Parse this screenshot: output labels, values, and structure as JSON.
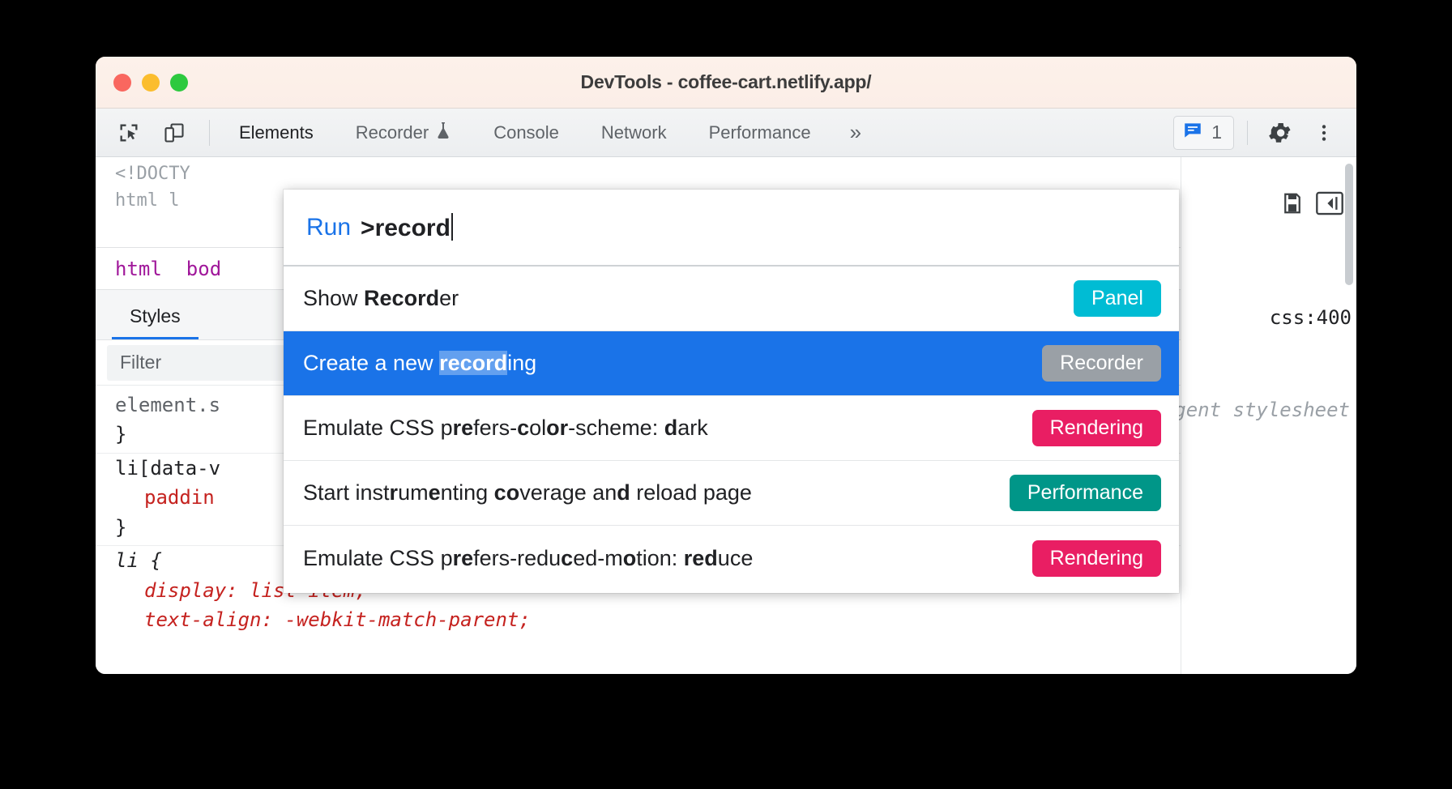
{
  "window": {
    "title": "DevTools - coffee-cart.netlify.app/",
    "traffic_lights": [
      "close-red",
      "minimize-yellow",
      "maximize-green"
    ]
  },
  "toolbar": {
    "inspect_icon": "inspect-element-icon",
    "device_icon": "device-toolbar-icon",
    "tabs": [
      {
        "label": "Elements",
        "active": true,
        "icon": null
      },
      {
        "label": "Recorder",
        "active": false,
        "icon": "flask-icon"
      },
      {
        "label": "Console",
        "active": false,
        "icon": null
      },
      {
        "label": "Network",
        "active": false,
        "icon": null
      },
      {
        "label": "Performance",
        "active": false,
        "icon": null
      }
    ],
    "more_tabs_label": "»",
    "message_badge": {
      "icon": "message-icon",
      "count": "1"
    },
    "settings_icon": "gear-icon",
    "more_options_icon": "kebab-menu-icon"
  },
  "command_menu": {
    "prefix_label": "Run",
    "query": ">record",
    "results": [
      {
        "parts": [
          {
            "t": "Show ",
            "b": false
          },
          {
            "t": "Record",
            "b": true
          },
          {
            "t": "er",
            "b": false
          }
        ],
        "badge": "Panel",
        "badge_color": "#00BCD4",
        "selected": false
      },
      {
        "parts": [
          {
            "t": "Create a new ",
            "b": false
          },
          {
            "t": "record",
            "b": true
          },
          {
            "t": "ing",
            "b": false
          }
        ],
        "badge": "Recorder",
        "badge_color": "#9AA0A6",
        "selected": true
      },
      {
        "parts": [
          {
            "t": "Emulate CSS p",
            "b": false
          },
          {
            "t": "re",
            "b": true
          },
          {
            "t": "fers-",
            "b": false
          },
          {
            "t": "c",
            "b": true
          },
          {
            "t": "ol",
            "b": false
          },
          {
            "t": "or",
            "b": true
          },
          {
            "t": "-scheme: ",
            "b": false
          },
          {
            "t": "d",
            "b": true
          },
          {
            "t": "ark",
            "b": false
          }
        ],
        "badge": "Rendering",
        "badge_color": "#E91E63",
        "selected": false
      },
      {
        "parts": [
          {
            "t": "Start inst",
            "b": false
          },
          {
            "t": "r",
            "b": true
          },
          {
            "t": "um",
            "b": false
          },
          {
            "t": "e",
            "b": true
          },
          {
            "t": "nting ",
            "b": false
          },
          {
            "t": "co",
            "b": true
          },
          {
            "t": "verage an",
            "b": false
          },
          {
            "t": "d",
            "b": true
          },
          {
            "t": " reload page",
            "b": false
          }
        ],
        "badge": "Performance",
        "badge_color": "#009688",
        "selected": false
      },
      {
        "parts": [
          {
            "t": "Emulate CSS p",
            "b": false
          },
          {
            "t": "re",
            "b": true
          },
          {
            "t": "fers-redu",
            "b": false
          },
          {
            "t": "c",
            "b": true
          },
          {
            "t": "ed-m",
            "b": false
          },
          {
            "t": "o",
            "b": true
          },
          {
            "t": "tion: ",
            "b": false
          },
          {
            "t": "red",
            "b": true
          },
          {
            "t": "uce",
            "b": false
          }
        ],
        "badge": "Rendering",
        "badge_color": "#E91E63",
        "selected": false
      }
    ]
  },
  "elements_panel": {
    "doctype_line": "<!DOCTY",
    "html_line": "html l",
    "breadcrumb": [
      "html",
      "bod"
    ]
  },
  "styles_panel": {
    "tab_label": "Styles",
    "filter_placeholder": "Filter",
    "rules": [
      {
        "selector": "element.s",
        "close": "}"
      },
      {
        "selector": "li[data-v",
        "prop": "paddin",
        "close": "}"
      },
      {
        "selector": "li {",
        "props": [
          "display: list-item;",
          "text-align: -webkit-match-parent;"
        ]
      }
    ],
    "source_right": "css:400",
    "ua_stylesheet_note": "user agent stylesheet",
    "right_icons": [
      "new-style-rule-icon",
      "toggle-sidebar-icon"
    ]
  }
}
